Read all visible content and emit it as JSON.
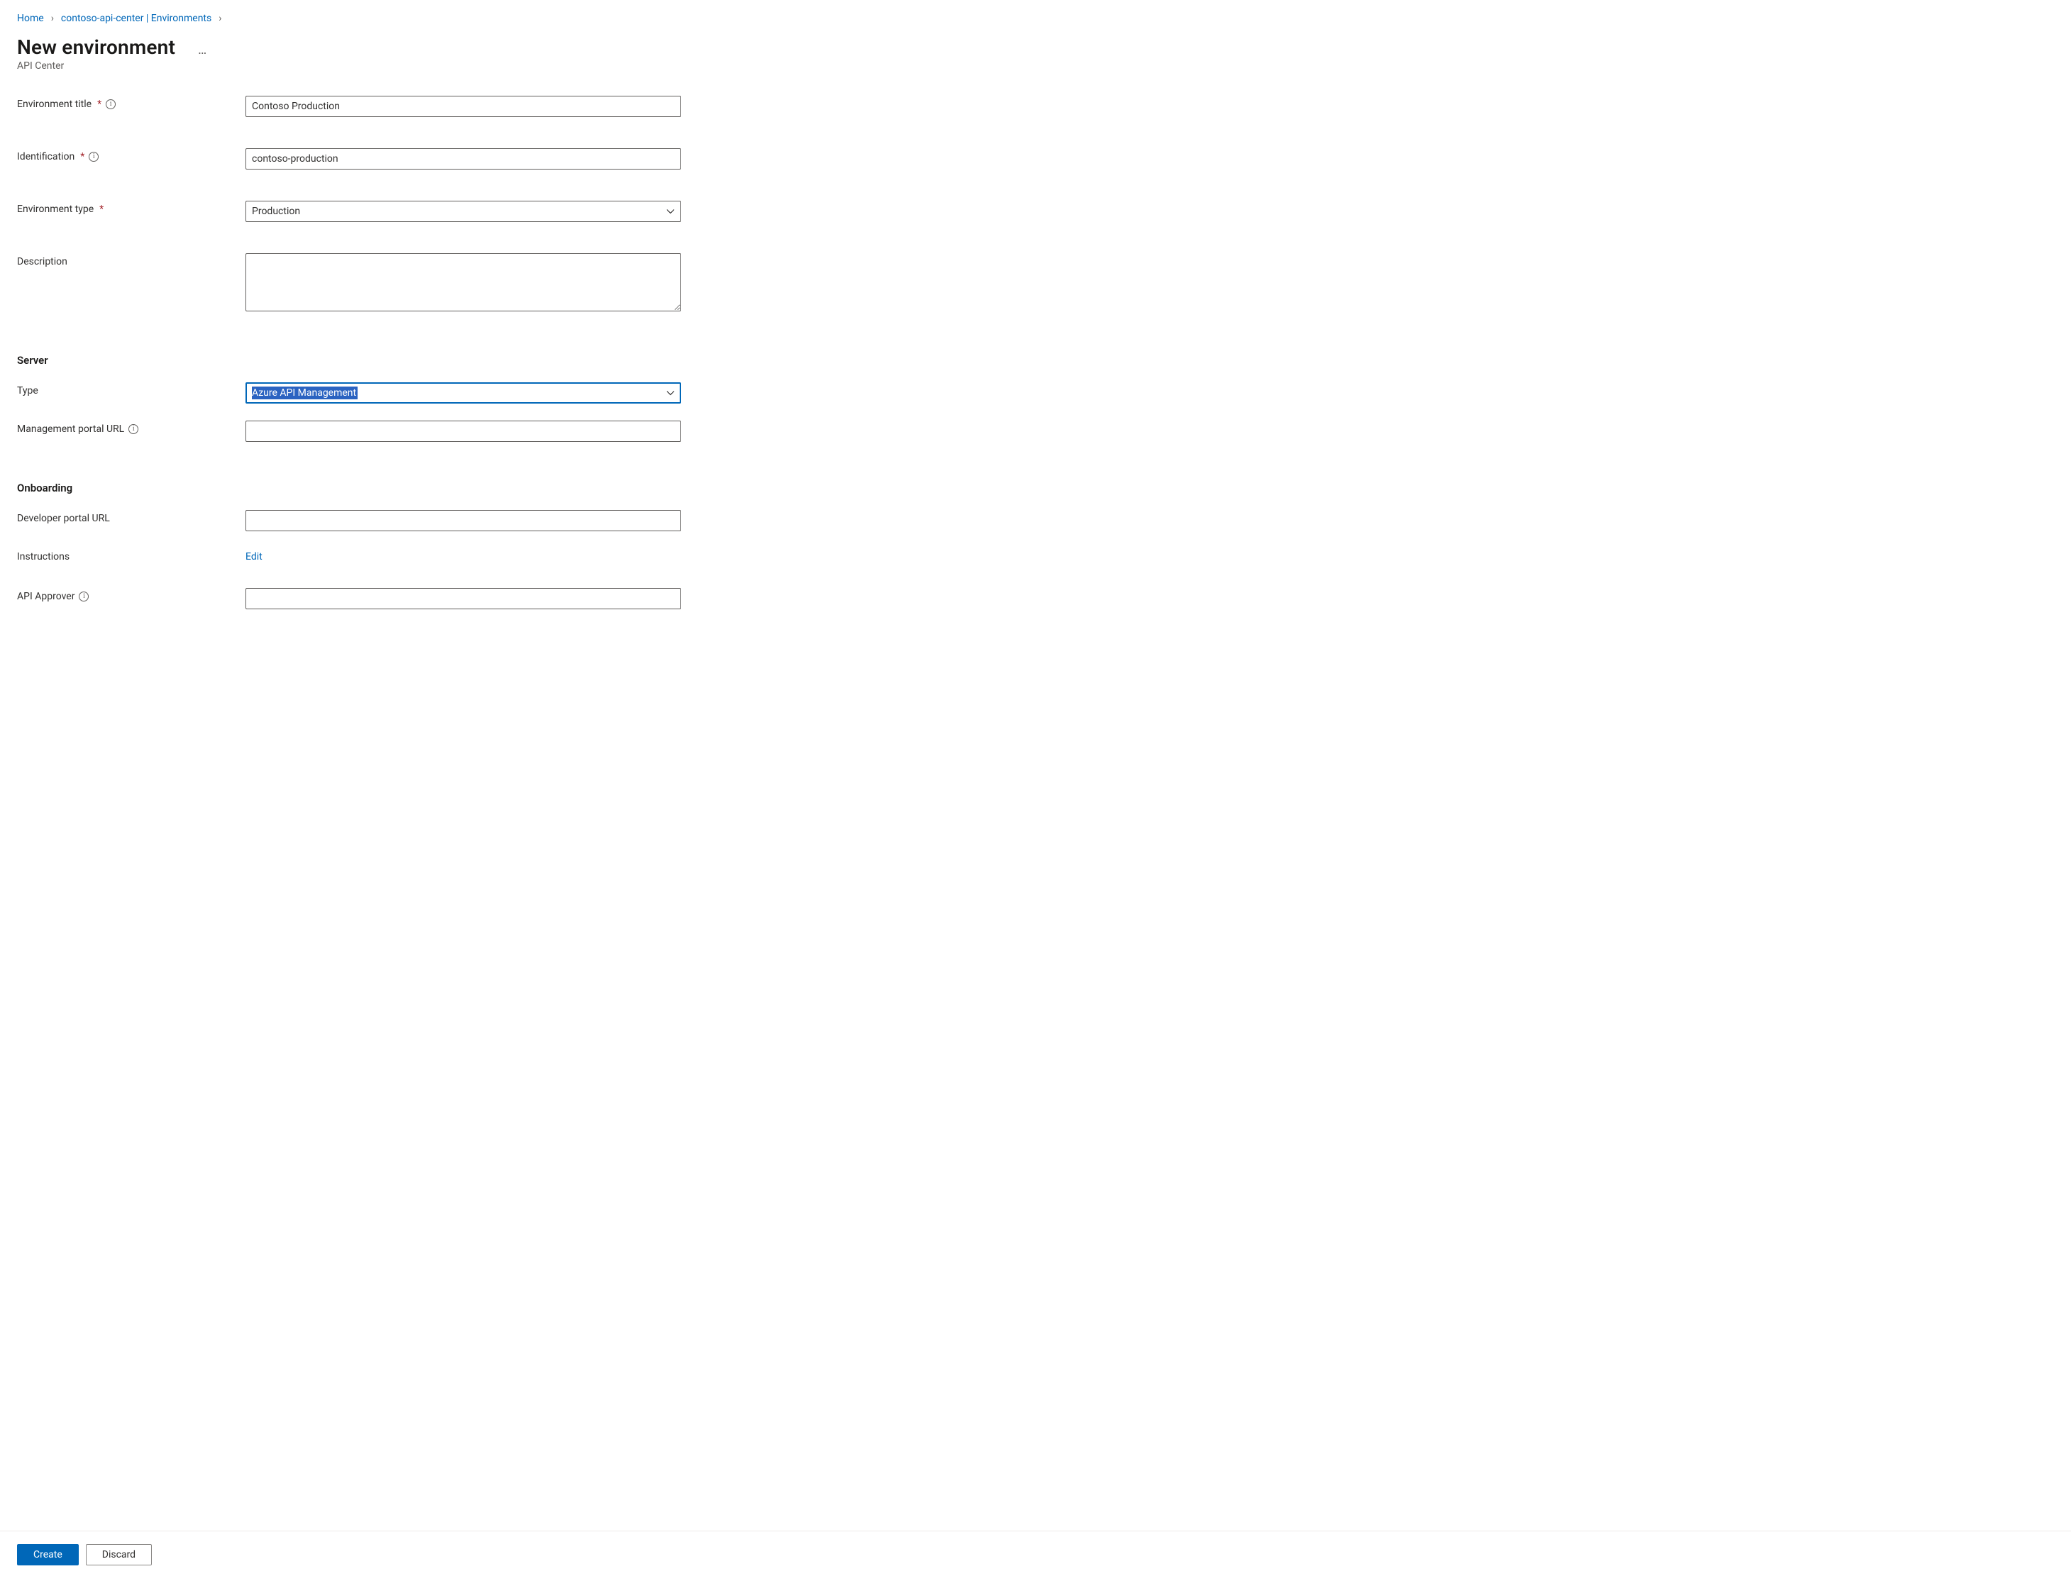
{
  "breadcrumb": {
    "home": "Home",
    "center": "contoso-api-center | Environments"
  },
  "header": {
    "title": "New environment",
    "subtitle": "API Center"
  },
  "form": {
    "env_title": {
      "label": "Environment title",
      "value": "Contoso Production"
    },
    "identification": {
      "label": "Identification",
      "value": "contoso-production"
    },
    "env_type": {
      "label": "Environment type",
      "value": "Production"
    },
    "description": {
      "label": "Description",
      "value": ""
    }
  },
  "server": {
    "heading": "Server",
    "type": {
      "label": "Type",
      "value": "Azure API Management"
    },
    "mgmt_url": {
      "label": "Management portal URL",
      "value": ""
    }
  },
  "onboarding": {
    "heading": "Onboarding",
    "dev_url": {
      "label": "Developer portal URL",
      "value": ""
    },
    "instructions": {
      "label": "Instructions",
      "action": "Edit"
    },
    "approver": {
      "label": "API Approver",
      "value": ""
    }
  },
  "footer": {
    "create": "Create",
    "discard": "Discard"
  }
}
